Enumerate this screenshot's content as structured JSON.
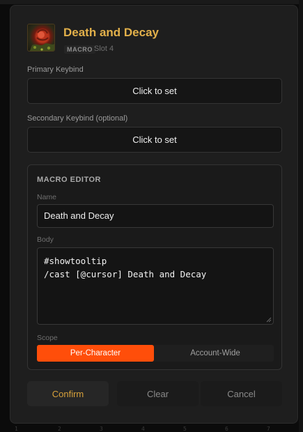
{
  "dialog": {
    "title": "Death and Decay",
    "type_badge": "MACRO",
    "slot": "Slot 4",
    "icon": "death-and-decay-spell-icon"
  },
  "primary_keybind": {
    "label": "Primary Keybind",
    "value": "Click to set"
  },
  "secondary_keybind": {
    "label": "Secondary Keybind (optional)",
    "value": "Click to set"
  },
  "editor": {
    "heading": "MACRO EDITOR",
    "name_label": "Name",
    "name_value": "Death and Decay",
    "body_label": "Body",
    "body_value": "#showtooltip\n/cast [@cursor] Death and Decay",
    "scope_label": "Scope",
    "scope_options": [
      "Per-Character",
      "Account-Wide"
    ],
    "scope_selected": "Per-Character"
  },
  "footer": {
    "confirm": "Confirm",
    "clear": "Clear",
    "cancel": "Cancel"
  },
  "background_numbers": [
    "1",
    "2",
    "3",
    "4",
    "5",
    "6",
    "7"
  ],
  "colors": {
    "accent_gold": "#e2b04a",
    "scope_active": "#ff4e0a",
    "dialog_bg": "#1e1e1e"
  }
}
